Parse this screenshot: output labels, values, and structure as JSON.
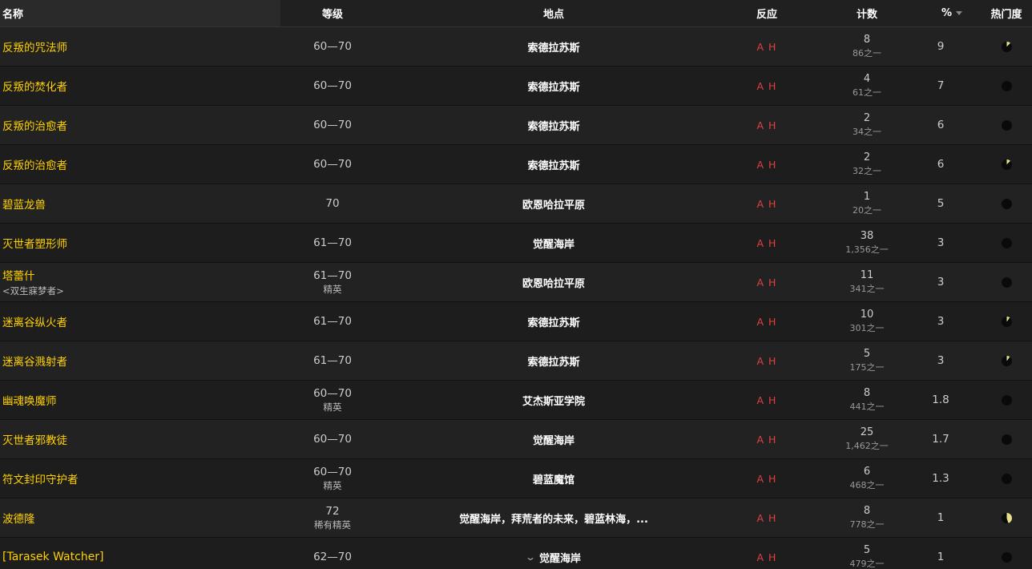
{
  "headers": {
    "name": "名称",
    "level": "等级",
    "zone": "地点",
    "react": "反应",
    "count": "计数",
    "pct": "%",
    "pop": "热门度"
  },
  "colors": {
    "name": "#ffd100",
    "hostile": "#e04040",
    "pie_fill": "#e6e08a",
    "pie_bg": "#0a0a0a"
  },
  "rows": [
    {
      "name": "反叛的咒法师",
      "tag": "",
      "level": "60—70",
      "level_sub": "",
      "zone": "索德拉苏斯",
      "zone_chevron": false,
      "react": "A H",
      "count": "8",
      "count_sub": "86之一",
      "pct": "9",
      "pop": 0.12
    },
    {
      "name": "反叛的焚化者",
      "tag": "",
      "level": "60—70",
      "level_sub": "",
      "zone": "索德拉苏斯",
      "zone_chevron": false,
      "react": "A H",
      "count": "4",
      "count_sub": "61之一",
      "pct": "7",
      "pop": 0
    },
    {
      "name": "反叛的治愈者",
      "tag": "",
      "level": "60—70",
      "level_sub": "",
      "zone": "索德拉苏斯",
      "zone_chevron": false,
      "react": "A H",
      "count": "2",
      "count_sub": "34之一",
      "pct": "6",
      "pop": 0
    },
    {
      "name": "反叛的治愈者",
      "tag": "",
      "level": "60—70",
      "level_sub": "",
      "zone": "索德拉苏斯",
      "zone_chevron": false,
      "react": "A H",
      "count": "2",
      "count_sub": "32之一",
      "pct": "6",
      "pop": 0.12
    },
    {
      "name": "碧蓝龙兽",
      "tag": "",
      "level": "70",
      "level_sub": "",
      "zone": "欧恩哈拉平原",
      "zone_chevron": false,
      "react": "A H",
      "count": "1",
      "count_sub": "20之一",
      "pct": "5",
      "pop": 0
    },
    {
      "name": "灭世者塑形师",
      "tag": "",
      "level": "61—70",
      "level_sub": "",
      "zone": "觉醒海岸",
      "zone_chevron": false,
      "react": "A H",
      "count": "38",
      "count_sub": "1,356之一",
      "pct": "3",
      "pop": 0
    },
    {
      "name": "塔蕾什",
      "tag": "<双生寐梦者>",
      "level": "61—70",
      "level_sub": "精英",
      "zone": "欧恩哈拉平原",
      "zone_chevron": false,
      "react": "A H",
      "count": "11",
      "count_sub": "341之一",
      "pct": "3",
      "pop": 0
    },
    {
      "name": "迷离谷纵火者",
      "tag": "",
      "level": "61—70",
      "level_sub": "",
      "zone": "索德拉苏斯",
      "zone_chevron": false,
      "react": "A H",
      "count": "10",
      "count_sub": "301之一",
      "pct": "3",
      "pop": 0.1
    },
    {
      "name": "迷离谷溅射者",
      "tag": "",
      "level": "61—70",
      "level_sub": "",
      "zone": "索德拉苏斯",
      "zone_chevron": false,
      "react": "A H",
      "count": "5",
      "count_sub": "175之一",
      "pct": "3",
      "pop": 0.1
    },
    {
      "name": "幽魂唤魔师",
      "tag": "",
      "level": "60—70",
      "level_sub": "精英",
      "zone": "艾杰斯亚学院",
      "zone_chevron": false,
      "react": "A H",
      "count": "8",
      "count_sub": "441之一",
      "pct": "1.8",
      "pop": 0
    },
    {
      "name": "灭世者邪教徒",
      "tag": "",
      "level": "60—70",
      "level_sub": "",
      "zone": "觉醒海岸",
      "zone_chevron": false,
      "react": "A H",
      "count": "25",
      "count_sub": "1,462之一",
      "pct": "1.7",
      "pop": 0
    },
    {
      "name": "符文封印守护者",
      "tag": "",
      "level": "60—70",
      "level_sub": "精英",
      "zone": "碧蓝魔馆",
      "zone_chevron": false,
      "react": "A H",
      "count": "6",
      "count_sub": "468之一",
      "pct": "1.3",
      "pop": 0
    },
    {
      "name": "波德隆",
      "tag": "",
      "level": "72",
      "level_sub": "稀有精英",
      "zone": "觉醒海岸，拜荒者的未来，碧蓝林海，...",
      "zone_chevron": false,
      "react": "A H",
      "count": "8",
      "count_sub": "778之一",
      "pct": "1",
      "pop": 0.45
    },
    {
      "name": "[Tarasek Watcher]",
      "tag": "",
      "level": "62—70",
      "level_sub": "",
      "zone": "觉醒海岸",
      "zone_chevron": true,
      "react": "A H",
      "count": "5",
      "count_sub": "479之一",
      "pct": "1",
      "pop": 0
    }
  ]
}
